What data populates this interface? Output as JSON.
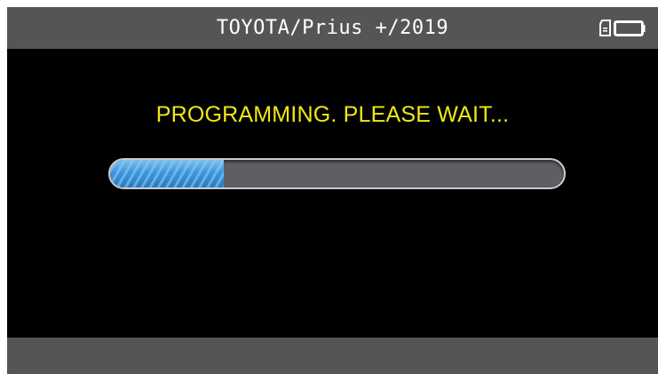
{
  "header": {
    "title": "TOYOTA/Prius +/2019",
    "icons": [
      "sd-card-icon",
      "battery-icon"
    ]
  },
  "main": {
    "message": "PROGRAMMING. PLEASE WAIT...",
    "progress_fraction": 0.25
  },
  "colors": {
    "header_bg": "#555555",
    "screen_bg": "#000000",
    "message_text": "#f0e814",
    "progress_fill": "#3d97dc",
    "progress_track": "#5d5f63"
  }
}
